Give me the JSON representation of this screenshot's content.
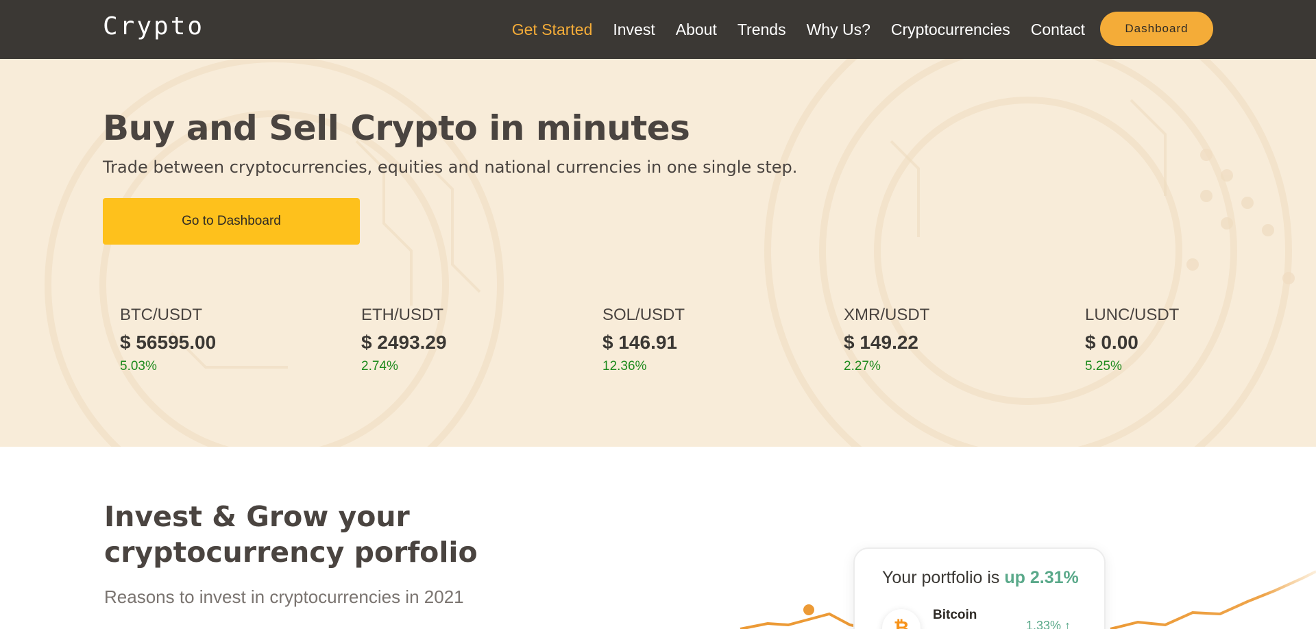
{
  "brand": {
    "logo": "Crypto"
  },
  "nav": {
    "links": [
      {
        "label": "Get Started",
        "active": true
      },
      {
        "label": "Invest"
      },
      {
        "label": "About"
      },
      {
        "label": "Trends"
      },
      {
        "label": "Why Us?"
      },
      {
        "label": "Cryptocurrencies"
      },
      {
        "label": "Contact"
      }
    ],
    "dashboard_button": "Dashboard"
  },
  "hero": {
    "title": "Buy and Sell Crypto in minutes",
    "subtitle": "Trade between cryptocurrencies, equities and national currencies in one single step.",
    "cta_label": "Go to Dashboard",
    "tickers": [
      {
        "pair": "BTC/USDT",
        "price": "$ 56595.00",
        "change": "5.03%"
      },
      {
        "pair": "ETH/USDT",
        "price": "$ 2493.29",
        "change": "2.74%"
      },
      {
        "pair": "SOL/USDT",
        "price": "$ 146.91",
        "change": "12.36%"
      },
      {
        "pair": "XMR/USDT",
        "price": "$ 149.22",
        "change": "2.27%"
      },
      {
        "pair": "LUNC/USDT",
        "price": "$ 0.00",
        "change": "5.25%"
      }
    ]
  },
  "invest": {
    "title": "Invest & Grow your cryptocurrency porfolio",
    "subtitle": "Reasons to invest in cryptocurrencies in 2021",
    "portfolio_card": {
      "title_prefix": "Your portfolio is",
      "title_highlight": "up 2.31%",
      "coin_symbol": "₿",
      "coin_name": "Bitcoin",
      "coin_change": "1.33% ↑"
    }
  },
  "colors": {
    "navbar_bg": "#3b3834",
    "accent": "#f4ac38",
    "cta": "#fec11c",
    "hero_bg": "#f8ecd9",
    "positive": "#1d8a1d",
    "card_positive": "#5aa98a"
  }
}
